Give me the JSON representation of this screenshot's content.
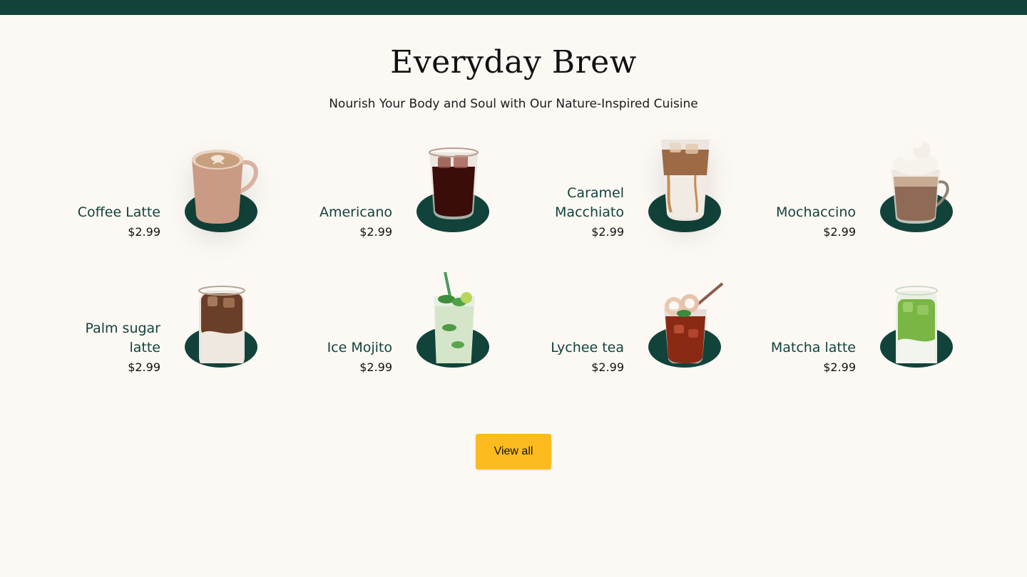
{
  "header": {
    "title": "Everyday Brew",
    "subtitle": "Nourish Your Body and Soul with Our Nature-Inspired Cuisine"
  },
  "menu": {
    "items": [
      {
        "name": "Coffee Latte",
        "price": "$2.99",
        "icon": "latte-cup-icon"
      },
      {
        "name": "Americano",
        "price": "$2.99",
        "icon": "americano-glass-icon"
      },
      {
        "name": "Caramel Macchiato",
        "price": "$2.99",
        "icon": "caramel-macchiato-icon"
      },
      {
        "name": "Mochaccino",
        "price": "$2.99",
        "icon": "mochaccino-icon"
      },
      {
        "name": "Palm sugar latte",
        "price": "$2.99",
        "icon": "palm-sugar-latte-icon"
      },
      {
        "name": "Ice Mojito",
        "price": "$2.99",
        "icon": "ice-mojito-icon"
      },
      {
        "name": "Lychee tea",
        "price": "$2.99",
        "icon": "lychee-tea-icon"
      },
      {
        "name": "Matcha latte",
        "price": "$2.99",
        "icon": "matcha-latte-icon"
      }
    ]
  },
  "actions": {
    "view_all_label": "View all"
  },
  "colors": {
    "brand_green": "#12433a",
    "accent_yellow": "#fdbb1e",
    "background": "#fcf8f4"
  }
}
